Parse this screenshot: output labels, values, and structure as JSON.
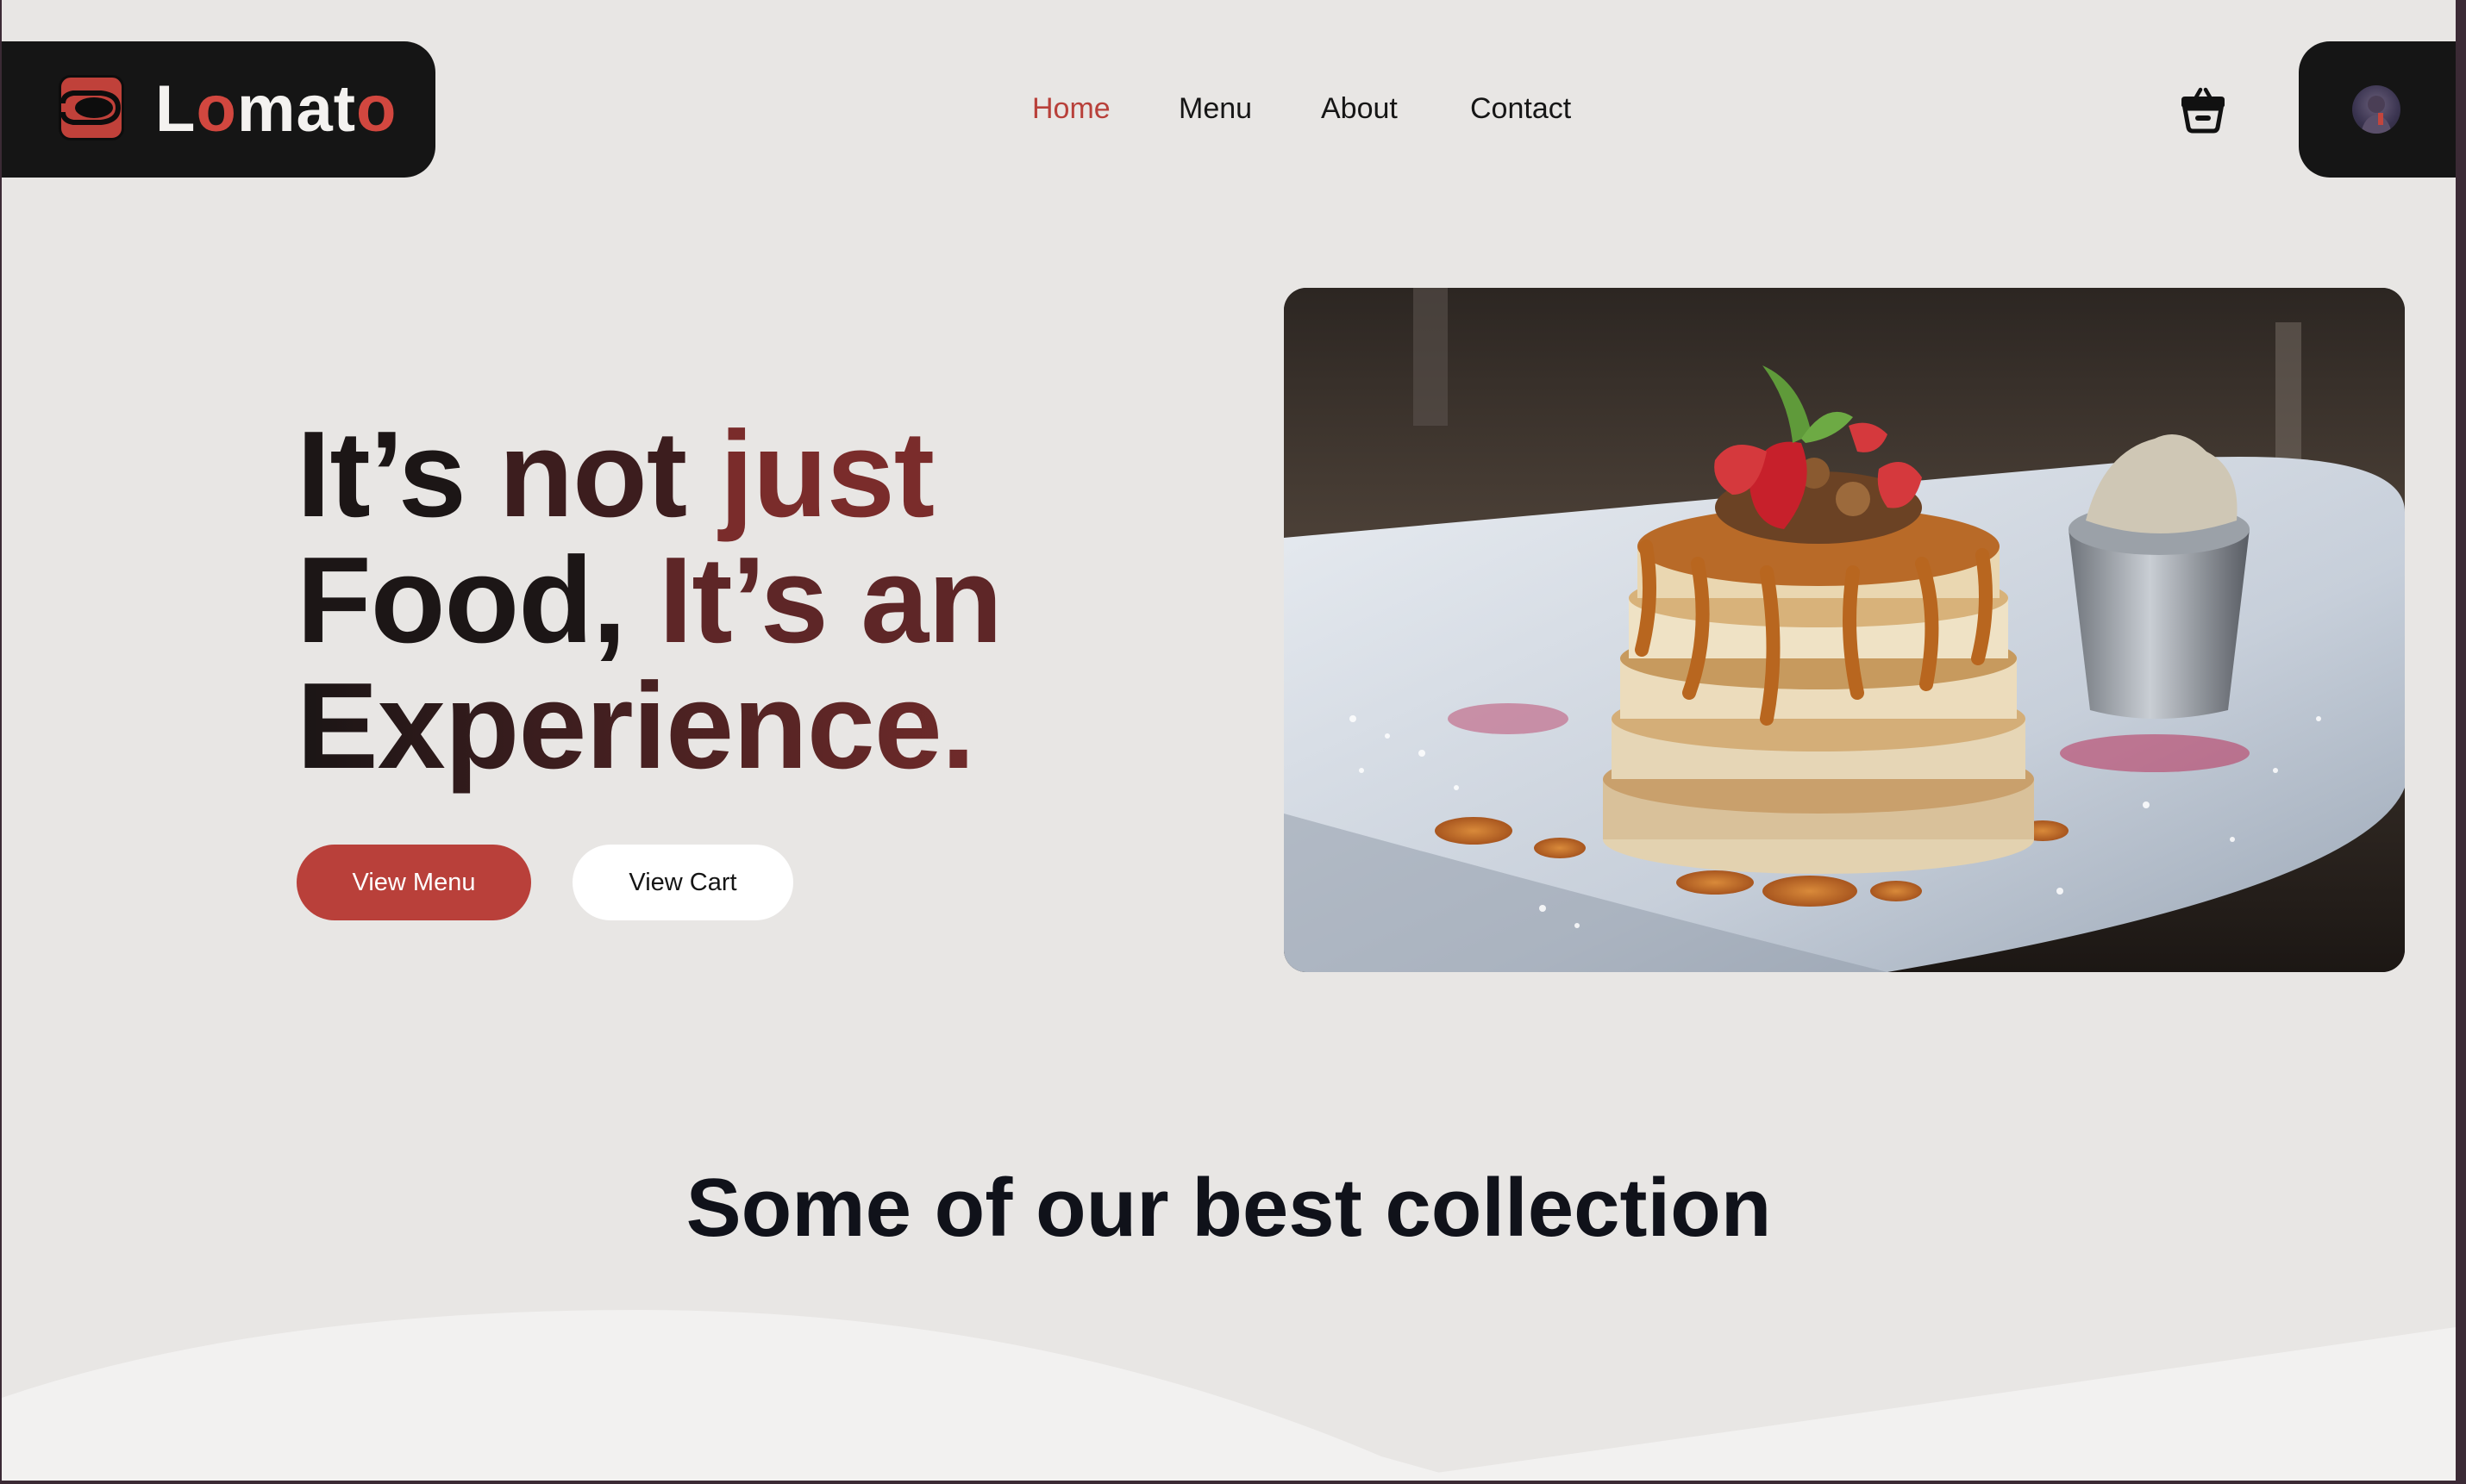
{
  "brand": {
    "name_parts": [
      "L",
      "o",
      "mat",
      "o"
    ],
    "accent_color": "#d2473f",
    "icon": "dish-icon"
  },
  "nav": {
    "items": [
      {
        "label": "Home",
        "active": true
      },
      {
        "label": "Menu",
        "active": false
      },
      {
        "label": "About",
        "active": false
      },
      {
        "label": "Contact",
        "active": false
      }
    ],
    "active_color": "#b8403a"
  },
  "header_actions": {
    "cart_icon": "basket-icon",
    "profile_icon": "avatar"
  },
  "hero": {
    "title_parts": [
      "It’s ",
      "not ",
      "just",
      "Food, ",
      "It’s an",
      "Experience."
    ],
    "buttons": {
      "primary": "View Menu",
      "secondary": "View Cart"
    },
    "primary_color": "#b9403a",
    "image": "pancake-stack-photo"
  },
  "collection": {
    "title": "Some of our best collection"
  }
}
